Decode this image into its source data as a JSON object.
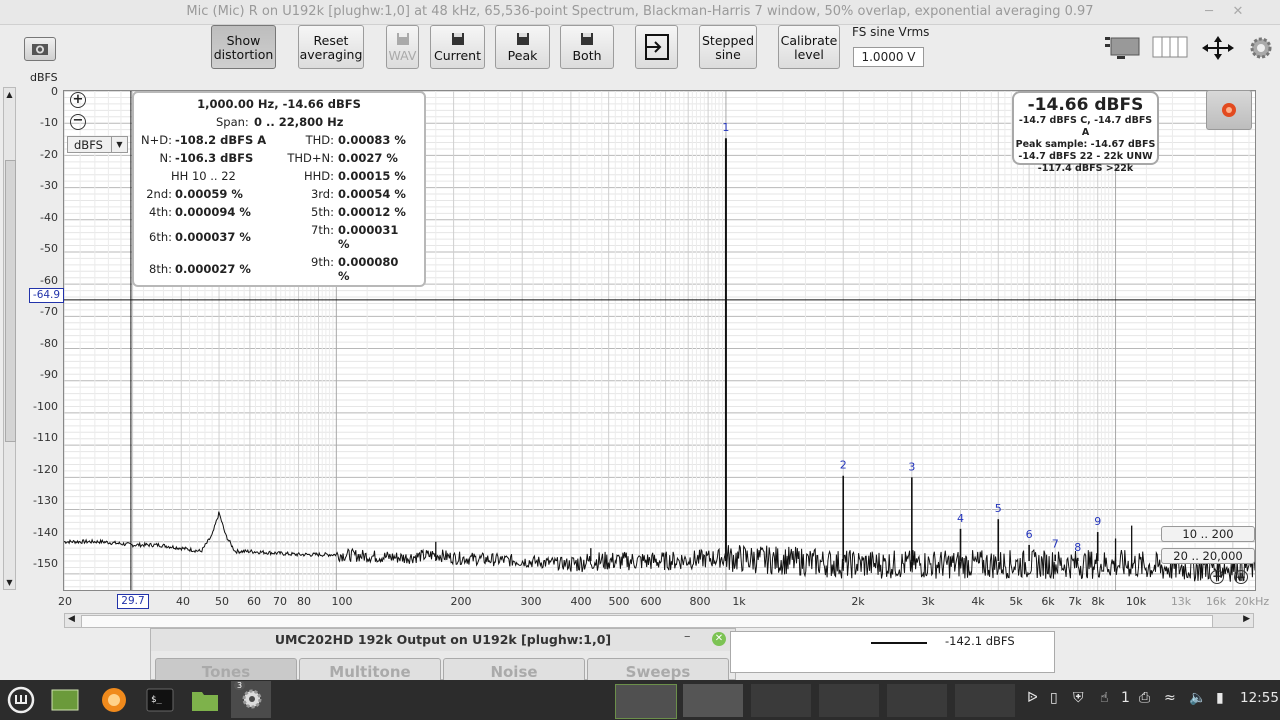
{
  "window": {
    "title": "Mic (Mic) R on U192k [plughw:1,0] at 48 kHz, 65,536-point Spectrum, Blackman-Harris 7 window, 50% overlap, exponential averaging 0.97",
    "minimize_icon": "minimize-icon",
    "close_icon": "close-icon"
  },
  "toolbar": {
    "show_distortion": "Show distortion",
    "reset_averaging": "Reset averaging",
    "wav": "WAV",
    "current": "Current",
    "peak": "Peak",
    "both": "Both",
    "stepped_sine": "Stepped sine",
    "calibrate_level": "Calibrate level",
    "fs_label": "FS sine Vrms",
    "fs_value": "1.0000 V"
  },
  "plot": {
    "y_unit": "dBFS",
    "y_unit_select": "dBFS",
    "y_ticks": [
      "0",
      "-10",
      "-20",
      "-30",
      "-40",
      "-50",
      "-60",
      "-70",
      "-80",
      "-90",
      "-100",
      "-110",
      "-120",
      "-130",
      "-140",
      "-150"
    ],
    "cursor_y": "-64.9",
    "cursor_x": "29.7",
    "x_ticks": [
      "20",
      "40",
      "50",
      "60",
      "70",
      "80",
      "100",
      "200",
      "300",
      "400",
      "500",
      "600",
      "800",
      "1k",
      "2k",
      "3k",
      "4k",
      "5k",
      "6k",
      "7k",
      "8k",
      "10k"
    ],
    "x_ticks_grey": [
      "13k",
      "16k",
      "20kHz"
    ],
    "harmonic_labels": [
      "1",
      "2",
      "3",
      "4",
      "5",
      "6",
      "7",
      "8",
      "9"
    ]
  },
  "info": {
    "header": "1,000.00 Hz, -14.66 dBFS",
    "span_label": "Span:",
    "span_value": "0 .. 22,800 Hz",
    "nd_label": "N+D:",
    "nd_value": "-108.2 dBFS A",
    "thd_label": "THD:",
    "thd_value": "0.00083 %",
    "n_label": "N:",
    "n_value": "-106.3 dBFS",
    "thdn_label": "THD+N:",
    "thdn_value": "0.0027 %",
    "hh_label": "HH 10 .. 22",
    "hhd_label": "HHD:",
    "hhd_value": "0.00015 %",
    "h2_label": "2nd:",
    "h2_value": "0.00059 %",
    "h3_label": "3rd:",
    "h3_value": "0.00054 %",
    "h4_label": "4th:",
    "h4_value": "0.000094 %",
    "h5_label": "5th:",
    "h5_value": "0.00012 %",
    "h6_label": "6th:",
    "h6_value": "0.000037 %",
    "h7_label": "7th:",
    "h7_value": "0.000031 %",
    "h8_label": "8th:",
    "h8_value": "0.000027 %",
    "h9_label": "9th:",
    "h9_value": "0.000080 %"
  },
  "peak": {
    "big": "-14.66 dBFS",
    "l1": "-14.7 dBFS C, -14.7 dBFS A",
    "l2": "Peak sample: -14.67 dBFS",
    "l3": "-14.7 dBFS 22 - 22k UNW",
    "l4": "-117.4 dBFS >22k"
  },
  "ranges": {
    "y_range": "10 .. 200",
    "x_range": "20 .. 20,000"
  },
  "generator": {
    "title": "UMC202HD 192k Output on U192k [plughw:1,0]",
    "tabs": [
      "Tones",
      "Multitone",
      "Noise",
      "Sweeps"
    ]
  },
  "legend": {
    "value": "-142.1 dBFS"
  },
  "taskbar": {
    "badge": "3",
    "network_count": "1",
    "clock": "12:55"
  },
  "chart_data": {
    "type": "line",
    "title": "",
    "xlabel": "",
    "ylabel": "dBFS",
    "xscale": "log",
    "xlim": [
      20,
      22800
    ],
    "ylim": [
      -155,
      0
    ],
    "grid": true,
    "noise_floor_dbfs": -145,
    "series": [
      {
        "x": [
          20,
          25,
          30,
          35,
          40,
          45,
          48,
          50,
          52,
          55,
          60,
          80,
          100,
          150,
          180,
          200,
          300,
          400,
          450,
          500,
          700,
          1000,
          1500,
          2000,
          3000,
          4000,
          5000,
          6000,
          7000,
          8000,
          9000,
          10000,
          11000,
          13000,
          16000,
          20000,
          22800
        ],
        "y": [
          -140,
          -140,
          -141,
          -141,
          -142,
          -143,
          -138,
          -131,
          -138,
          -143,
          -143,
          -144,
          -144,
          -145,
          -144,
          -145,
          -146,
          -147,
          -146,
          -146,
          -146,
          -145,
          -146,
          -147,
          -147,
          -147,
          -147,
          -147,
          -147,
          -147,
          -147,
          -147,
          -147,
          -148,
          -148,
          -148,
          -148
        ]
      }
    ],
    "harmonics": [
      {
        "n": 1,
        "freq": 1000,
        "level": -14.66
      },
      {
        "n": 2,
        "freq": 2000,
        "level": -119.5
      },
      {
        "n": 3,
        "freq": 3000,
        "level": -120
      },
      {
        "n": 4,
        "freq": 4000,
        "level": -136
      },
      {
        "n": 5,
        "freq": 5000,
        "level": -133
      },
      {
        "n": 6,
        "freq": 6000,
        "level": -141
      },
      {
        "n": 7,
        "freq": 7000,
        "level": -144
      },
      {
        "n": 8,
        "freq": 8000,
        "level": -145
      },
      {
        "n": 9,
        "freq": 9000,
        "level": -137
      }
    ],
    "extra_peaks": [
      {
        "freq": 180,
        "level": -140
      },
      {
        "freq": 450,
        "level": -142
      },
      {
        "freq": 10000,
        "level": -139
      },
      {
        "freq": 11000,
        "level": -135
      }
    ]
  }
}
